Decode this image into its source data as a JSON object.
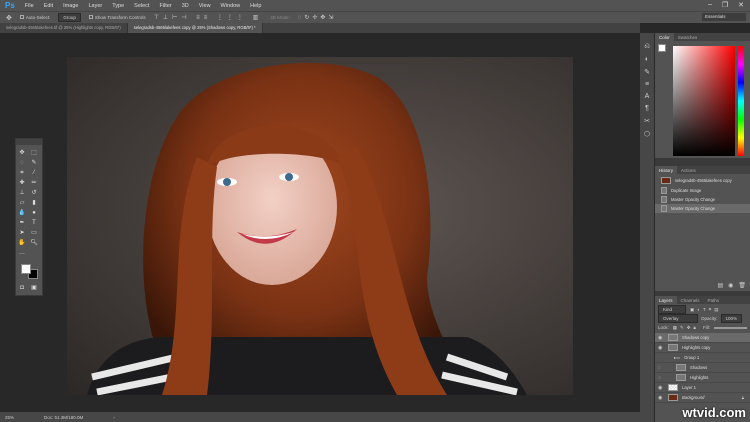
{
  "app": {
    "logo": "Ps"
  },
  "menu": [
    "File",
    "Edit",
    "Image",
    "Layer",
    "Type",
    "Select",
    "Filter",
    "3D",
    "View",
    "Window",
    "Help"
  ],
  "window_controls": [
    "–",
    "❐",
    "✕"
  ],
  "options": {
    "auto_select": "Auto-Select:",
    "group": "Group",
    "transform": "Show Transform Controls",
    "mode_3d": "3D Mode:",
    "workspace": "Essentials"
  },
  "tabs": [
    {
      "label": "selegradsb-4565lakefees.tif @ 25% (Highlights copy, RGB/8*)",
      "active": false
    },
    {
      "label": "selegradsb-4565lakefees copy @ 25% (Shadows copy, RGB/8*) *",
      "active": true
    }
  ],
  "status": {
    "zoom": "25%",
    "doc": "Doc: 51.3M/180.0M"
  },
  "color_panel": {
    "tabs": [
      "Color",
      "Swatches"
    ]
  },
  "history": {
    "tabs": [
      "History",
      "Actions"
    ],
    "snapshot": "selegradsb-4565lakefees copy",
    "items": [
      "Duplicate Image",
      "Master Opacity Change",
      "Master Opacity Change"
    ]
  },
  "layers": {
    "tabs": [
      "Layers",
      "Channels",
      "Paths"
    ],
    "filter": "Kind",
    "blend": "Overlay",
    "opacity_label": "Opacity:",
    "opacity": "100%",
    "lock_label": "Lock:",
    "fill_label": "Fill:",
    "items": [
      {
        "name": "Shadows copy",
        "selected": true,
        "indent": 0
      },
      {
        "name": "Highlights copy",
        "indent": 0
      },
      {
        "name": "Group 1",
        "indent": 0,
        "group": true
      },
      {
        "name": "Shadows",
        "indent": 1
      },
      {
        "name": "Highlights",
        "indent": 1
      },
      {
        "name": "Layer 1",
        "indent": 0
      },
      {
        "name": "Background",
        "indent": 0,
        "locked": true
      }
    ]
  },
  "watermark": "wtvid.com",
  "colors": {
    "accent": "#31a8ff",
    "fg": "#ffffff",
    "bg": "#000000"
  }
}
